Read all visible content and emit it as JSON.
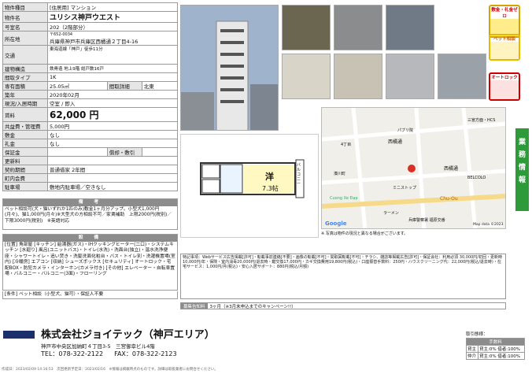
{
  "left_table": {
    "property_type": {
      "label": "物件種目",
      "value": "[住居用] マンション"
    },
    "name": {
      "label": "物件名",
      "value": "ユリシス神戸ウエスト"
    },
    "room": {
      "label": "号室名",
      "value": "202（2階部分）"
    },
    "address": {
      "label": "所在地",
      "zip": "〒652-0034",
      "value": "兵庫県神戸市兵庫区西橘通２丁目4-16"
    },
    "transport": {
      "label": "交通",
      "value": "東海道線「神戸」徒歩11分"
    },
    "structure": {
      "label": "建物構造",
      "value": "鉄骨造 地上9階 総戸数16戸"
    },
    "layout": {
      "label": "間取タイプ",
      "value": "1K"
    },
    "area": {
      "label": "専有面積",
      "value": "25.05㎡",
      "detail_label": "間取詳細",
      "detail_value": "北東"
    },
    "built": {
      "label": "築年",
      "value": "2020年02月"
    },
    "status": {
      "label": "現況/入居時期",
      "value": "空室 / 即入"
    },
    "rent": {
      "label": "賃料",
      "value": "62,000 円"
    },
    "common_fee": {
      "label": "共益費・管理費",
      "value": "5,000円"
    },
    "deposit": {
      "label": "敷金",
      "value": "なし"
    },
    "key_money": {
      "label": "礼金",
      "value": "なし"
    },
    "guarantee": {
      "label": "保証金",
      "value": "",
      "sub_label": "償却・敷引",
      "sub_value": ""
    },
    "renewal": {
      "label": "更新料",
      "value": ""
    },
    "contract": {
      "label": "契約期間",
      "value": "普通借家 2年間"
    },
    "insurance": {
      "label": "町内会費",
      "value": ""
    },
    "parking": {
      "label": "駐車場",
      "value": "敷地内駐車場／空きなし"
    }
  },
  "remarks": {
    "header": "備　考",
    "text": "ペット相談可(犬・猫いずれか1匹のみ)敷金1ヶ月分アップ。小型犬1,000円(月々)、猫1,000円(月々)※大型犬の方相談不可／家賃補助　上限2000円(税別)／下限3000円(税別)　※英語対応"
  },
  "equipment": {
    "header": "設　備",
    "text": "[位置] 角部屋 [キッチン] 給湯器(ガス)・IHクッキングヒーター(二口)・システムキッチン [水廻り] 風呂(ユニットバス)・トイレ(水洗)・洗面台(独立)・温水洗浄便座・シャワートイレ・追い焚き・洗髪洗面化粧台・バス・トイレ別・洗濯機置場(室内) [冷暖房] エアコン [収納] シューズボックス [セキュリティ] オートロック・宅配BOX・防犯カメラ・インターホン(カメラ付き) [その他] エレベーター・自転車置場・バルコニー・バルコニー(3面)・フローリング"
  },
  "conditions": {
    "label": "条件",
    "value": "[条件] ペット相談（小型犬、猫可）・保証人不要"
  },
  "badges": {
    "no_deposit": "敷金・礼金ゼロ",
    "pet": "ペット相談",
    "autolock": "オートロック"
  },
  "floor_plan": {
    "room_label": "洋",
    "room_size": "7.3帖",
    "balcony": "バルコニー"
  },
  "map_credit": "Map data ©2023",
  "map_labels": [
    "西橘通",
    "4丁目",
    "パブリ院",
    "湊川町",
    "西橘通",
    "ミニストップ",
    "三宮方面・HCS",
    "Chu-Ou",
    "BELCOLO",
    "兵庫警察署 福原交番",
    "Cuong Xe Đạp",
    "ラーメン",
    "Google"
  ],
  "photo_note": "※ 写真は物件の現況と異なる場合がございます。",
  "fee_notes": "特記事項：Webサービス広告掲載[許可]・転載事前連絡[不要]・画像の転載[不可]・間取図転載[不可]・チラシ、雑誌等掲載広告[許可]・保証会社：利用必須 30,000円/初回・更新時10,000円/年・保険・室内消毒20,000円/退去時・鍵交換17,000円・カギ交換費用19,800円(税込)・口座振替手数料：250円・ハウスクリーニング代：22,000円(税込/退去時)・在宅サービス：1,000円/月(税込)・安心入居サポート：880円(税込/月額)",
  "campaign": {
    "label": "募集告知料",
    "value": "3ヶ月（※3月末申込までのキャンペーン!!）"
  },
  "company": {
    "name": "株式会社ジョイテック（神戸エリア）",
    "address": "神戸市中央区加納町４丁目3-5　三宮御幸ビル4階",
    "tel": "TEL：078-322-2122",
    "fax": "FAX：078-322-2123"
  },
  "transaction": {
    "title": "取引態様：",
    "fee_header": "手数料",
    "rows": [
      {
        "type": "貸主",
        "val": "貸主:0% 借者:100%"
      },
      {
        "type": "仲介",
        "val": "貸主:0% 借者:100%"
      }
    ]
  },
  "side_tab": "業務情報",
  "footer": "作成日：2023/02/09 14:16:53　次回更新予定日：2023/02/16　※情報は掲載時点のものです。詳細は取扱業者にお問合せください。"
}
